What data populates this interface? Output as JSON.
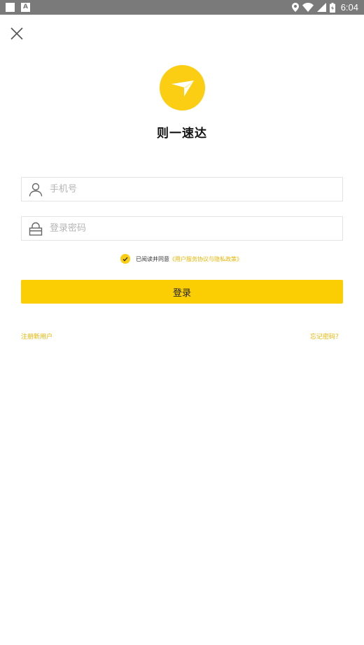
{
  "status_bar": {
    "time": "6:04",
    "a_glyph": "A",
    "icons": [
      "location-icon",
      "wifi-icon",
      "signal-icon",
      "battery-icon"
    ]
  },
  "app": {
    "name": "则一速达",
    "logo_color": "#fbcd13"
  },
  "form": {
    "phone_placeholder": "手机号",
    "password_placeholder": "登录密码",
    "agree_text": "已阅读并同意",
    "agree_link": "《用户服务协议与隐私政策》",
    "agreement_checked": true,
    "login_label": "登录"
  },
  "links": {
    "register": "注册新用户",
    "forgot": "忘记密码？"
  },
  "colors": {
    "accent": "#fbcd03",
    "link": "#e7b400",
    "status_bar": "#7a7a7a"
  }
}
